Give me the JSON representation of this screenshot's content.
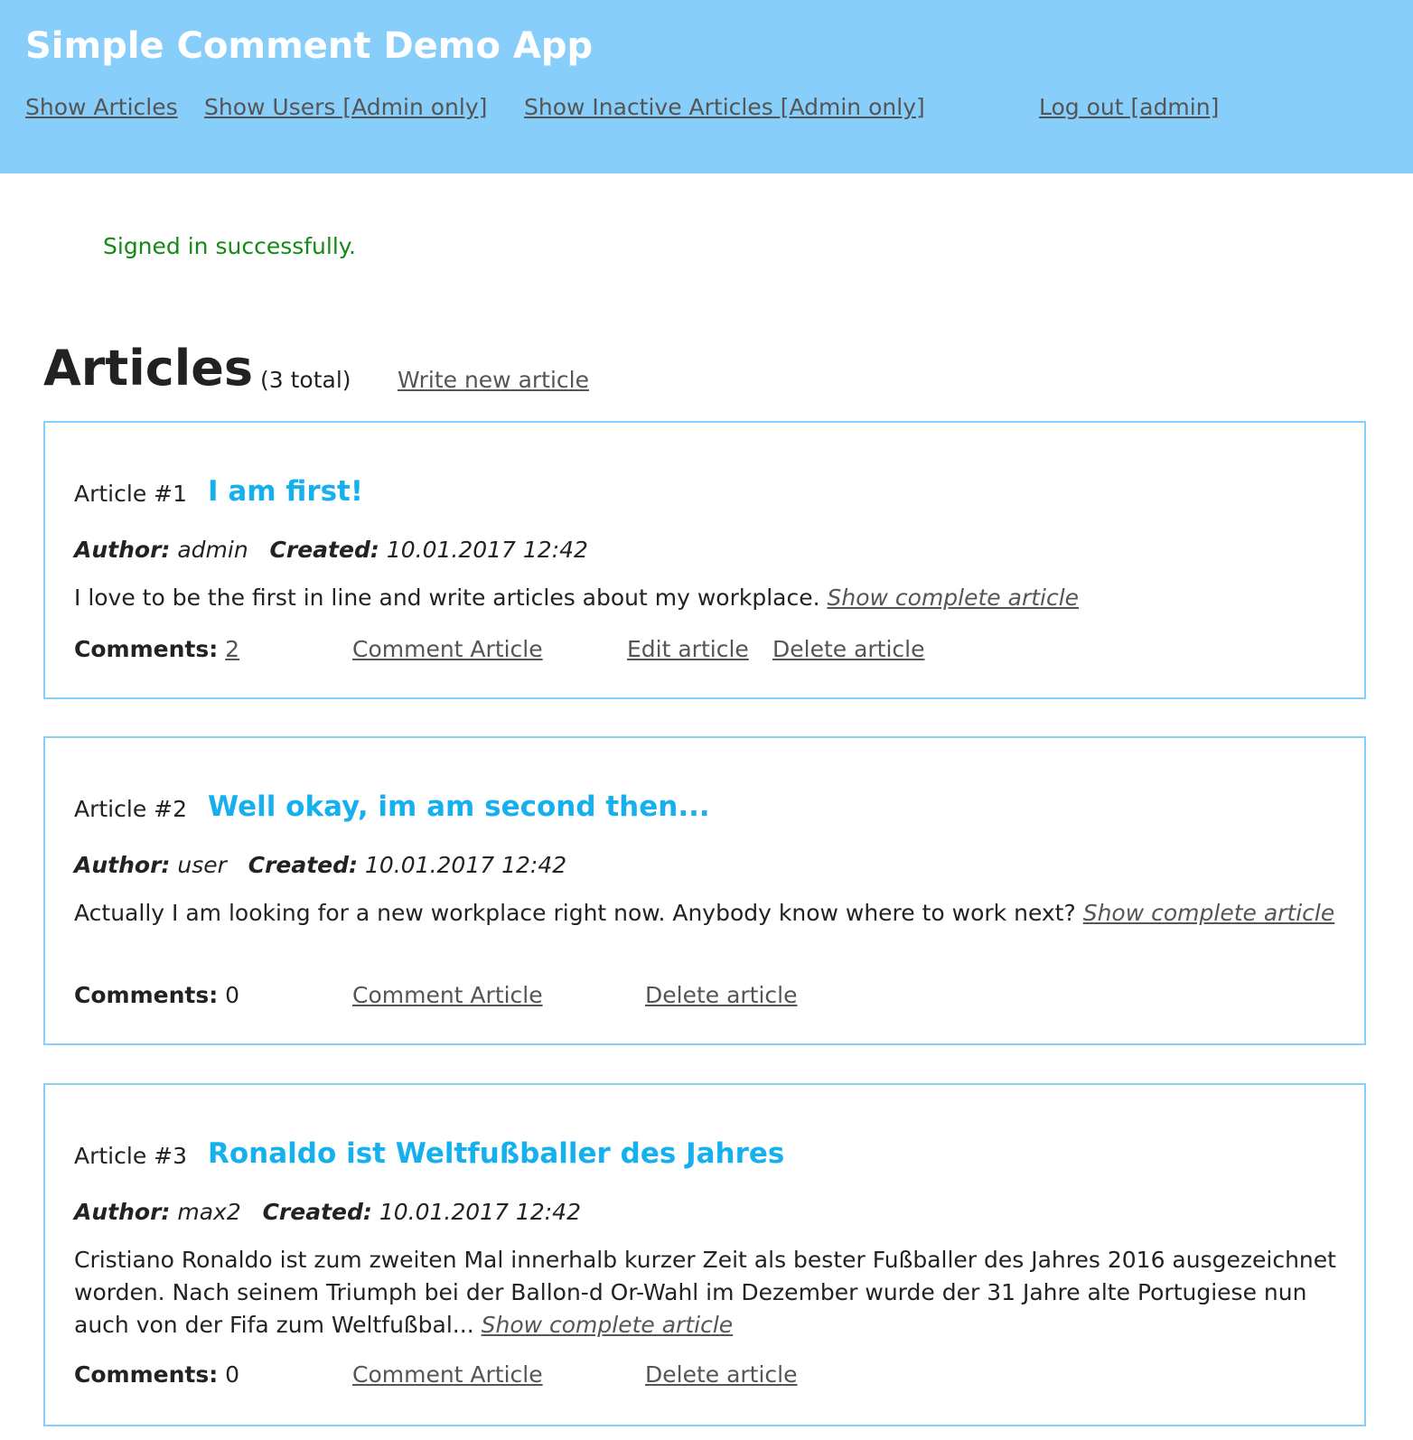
{
  "header": {
    "title": "Simple Comment Demo App",
    "nav": {
      "show_articles": "Show Articles",
      "show_users": "Show Users [Admin only]",
      "show_inactive": "Show Inactive Articles [Admin only]",
      "logout": "Log out [admin]"
    },
    "background_color": "#87cefa"
  },
  "flash": {
    "message": "Signed in successfully.",
    "color": "#138a13"
  },
  "articles_section": {
    "title": "Articles",
    "count": "(3 total)",
    "write_new": "Write new article"
  },
  "labels": {
    "author": "Author:",
    "created": "Created:",
    "comments": "Comments:",
    "comment_article": "Comment Article",
    "edit_article": "Edit article",
    "delete_article": "Delete article",
    "show_complete": "Show complete article"
  },
  "articles": [
    {
      "label": "Article #1",
      "title": "I am first!",
      "author": "admin",
      "created": "10.01.2017 12:42",
      "body": "I love to be the first in line and write articles about my workplace.",
      "comments": "2"
    },
    {
      "label": "Article #2",
      "title": "Well okay, im am second then...",
      "author": "user",
      "created": "10.01.2017 12:42",
      "body": "Actually I am looking for a new workplace right now. Anybody know where to work next?",
      "comments": "0"
    },
    {
      "label": "Article #3",
      "title": "Ronaldo ist Weltfußballer des Jahres",
      "author": "max2",
      "created": "10.01.2017 12:42",
      "body": "Cristiano Ronaldo ist zum zweiten Mal innerhalb kurzer Zeit als bester Fußballer des Jahres 2016 ausgezeichnet worden. Nach seinem Triumph bei der Ballon-d Or-Wahl im Dezember wurde der 31 Jahre alte Portugiese nun auch von der Fifa zum Weltfußbal...",
      "comments": "0"
    }
  ]
}
